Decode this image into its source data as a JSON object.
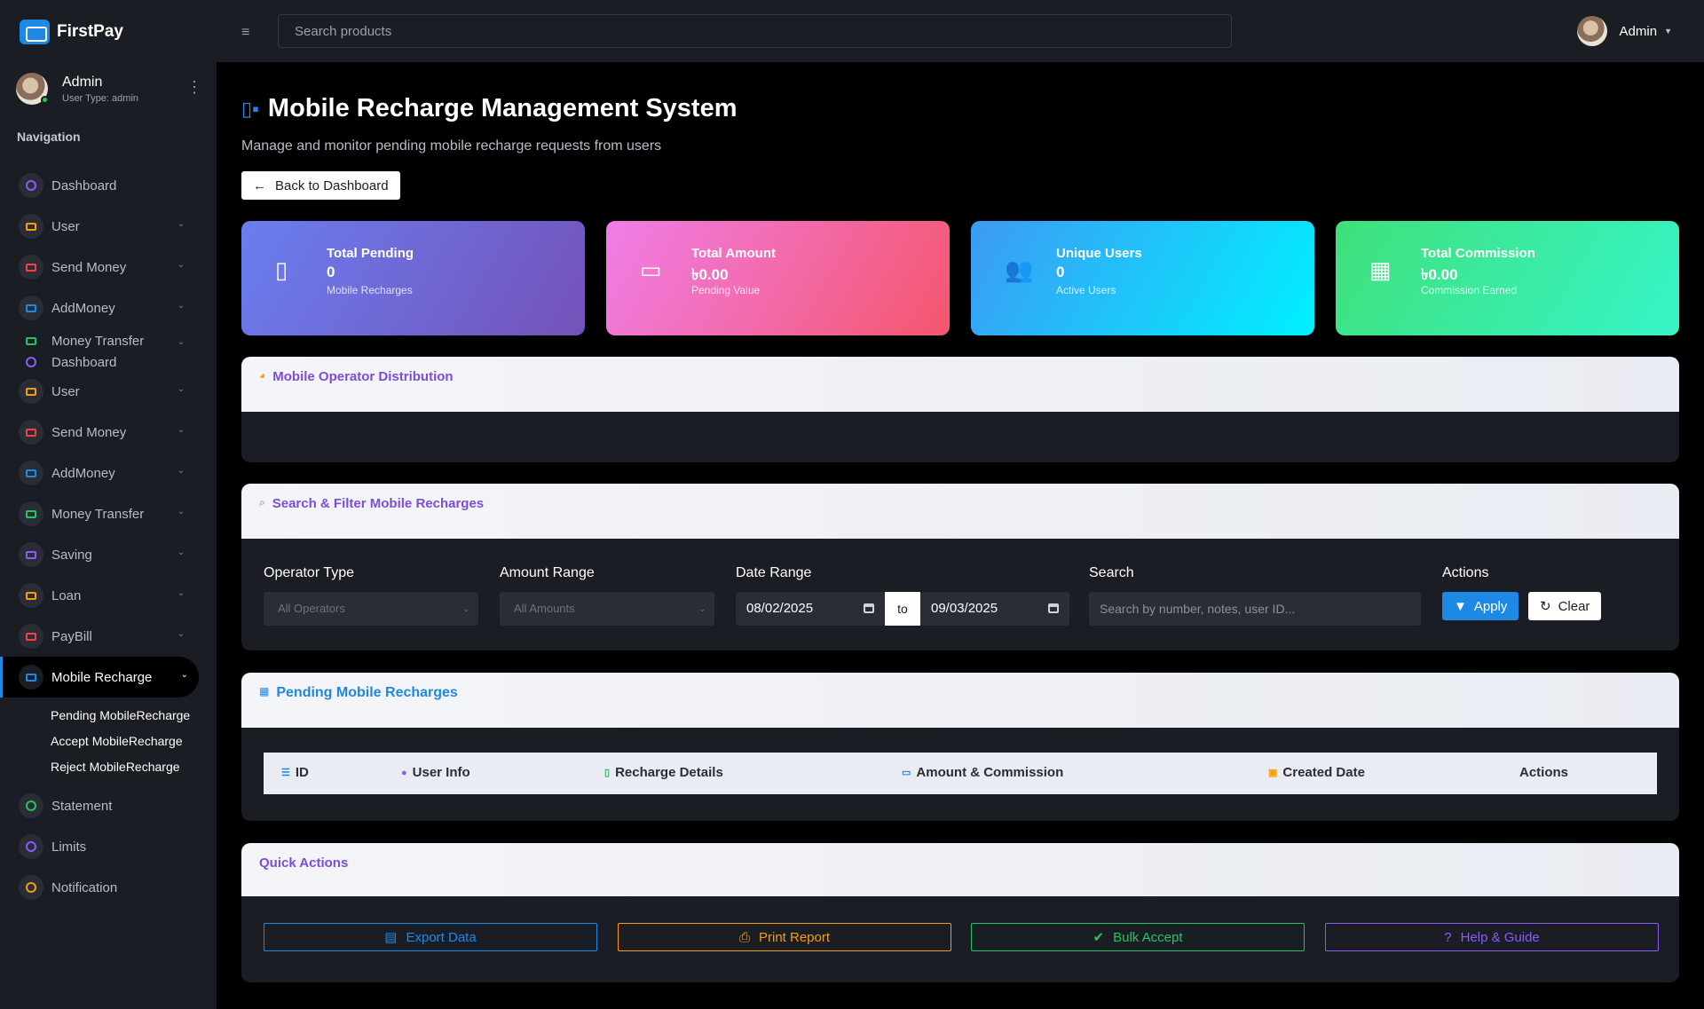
{
  "brand": {
    "name": "FirstPay"
  },
  "profile": {
    "name": "Admin",
    "user_type": "User Type: admin"
  },
  "nav": {
    "title": "Navigation",
    "items": [
      {
        "label": "Dashboard",
        "color": "#8b5cf6",
        "icon": "gauge-icon"
      },
      {
        "label": "User",
        "color": "#f59e0b",
        "icon": "laptop-icon",
        "chevron": true
      },
      {
        "label": "Send Money",
        "color": "#ef4444",
        "icon": "laptop-icon",
        "chevron": true
      },
      {
        "label": "AddMoney",
        "color": "#1e88e5",
        "icon": "laptop-icon",
        "chevron": true
      },
      {
        "label": "Money Transfer",
        "label2": "Dashboard",
        "color": "#22c55e",
        "icon": "laptop-icon",
        "chevron": true
      },
      {
        "label": "User",
        "color": "#f59e0b",
        "icon": "laptop-icon",
        "chevron": true
      },
      {
        "label": "Send Money",
        "color": "#ef4444",
        "icon": "laptop-icon",
        "chevron": true
      },
      {
        "label": "AddMoney",
        "color": "#1e88e5",
        "icon": "laptop-icon",
        "chevron": true
      },
      {
        "label": "Money Transfer",
        "color": "#22c55e",
        "icon": "laptop-icon",
        "chevron": true
      },
      {
        "label": "Saving",
        "color": "#8b5cf6",
        "icon": "laptop-icon",
        "chevron": true
      },
      {
        "label": "Loan",
        "color": "#f59e0b",
        "icon": "laptop-icon",
        "chevron": true
      },
      {
        "label": "PayBill",
        "color": "#ef4444",
        "icon": "laptop-icon",
        "chevron": true
      },
      {
        "label": "Mobile Recharge",
        "color": "#1e88e5",
        "icon": "laptop-icon",
        "chevron": true,
        "active": true
      },
      {
        "label": "Statement",
        "color": "#22c55e",
        "icon": "gauge-icon"
      },
      {
        "label": "Limits",
        "color": "#8b5cf6",
        "icon": "gauge-icon"
      },
      {
        "label": "Notification",
        "color": "#f59e0b",
        "icon": "gauge-icon"
      }
    ],
    "sub_items": [
      "Pending MobileRecharge",
      "Accept MobileRecharge",
      "Reject MobileRecharge"
    ]
  },
  "topbar": {
    "search_placeholder": "Search products",
    "user_name": "Admin"
  },
  "page": {
    "title": "Mobile Recharge Management System",
    "subtitle": "Manage and monitor pending mobile recharge requests from users",
    "back_label": "Back to Dashboard"
  },
  "stats": [
    {
      "title": "Total Pending",
      "value": "0",
      "sub": "Mobile Recharges",
      "icon": "phone-icon"
    },
    {
      "title": "Total Amount",
      "value": "৳0.00",
      "sub": "Pending Value",
      "icon": "money-icon"
    },
    {
      "title": "Unique Users",
      "value": "0",
      "sub": "Active Users",
      "icon": "users-icon"
    },
    {
      "title": "Total Commission",
      "value": "৳0.00",
      "sub": "Commission Earned",
      "icon": "calculator-icon"
    }
  ],
  "operator_card": {
    "title": "Mobile Operator Distribution"
  },
  "filter_card": {
    "title": "Search & Filter Mobile Recharges",
    "operator_label": "Operator Type",
    "operator_value": "All Operators",
    "amount_label": "Amount Range",
    "amount_value": "All Amounts",
    "date_label": "Date Range",
    "date_from": "08/02/2025",
    "date_to_word": "to",
    "date_to": "09/03/2025",
    "search_label": "Search",
    "search_placeholder": "Search by number, notes, user ID...",
    "actions_label": "Actions",
    "apply_label": "Apply",
    "clear_label": "Clear"
  },
  "table_card": {
    "title": "Pending Mobile Recharges",
    "columns": [
      "ID",
      "User Info",
      "Recharge Details",
      "Amount & Commission",
      "Created Date",
      "Actions"
    ]
  },
  "quick_actions": {
    "title": "Quick Actions",
    "buttons": [
      {
        "label": "Export Data",
        "color": "#1e88e5"
      },
      {
        "label": "Print Report",
        "color": "#f59e0b"
      },
      {
        "label": "Bulk Accept",
        "color": "#22c55e"
      },
      {
        "label": "Help & Guide",
        "color": "#8b5cf6"
      }
    ]
  }
}
